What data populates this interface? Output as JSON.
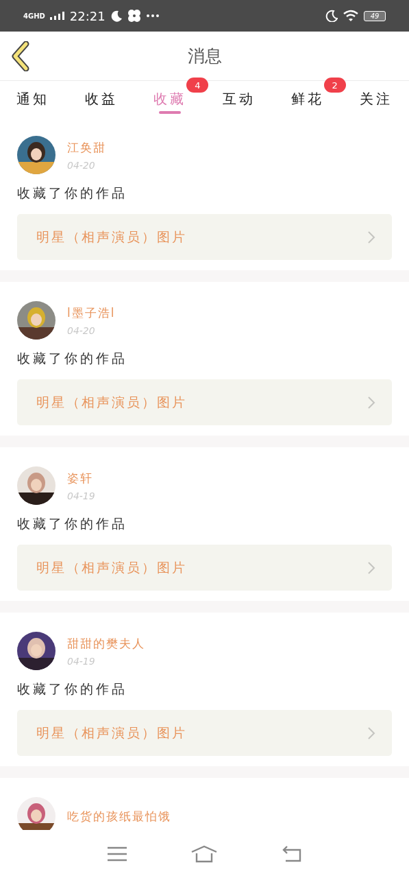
{
  "status_bar": {
    "network": "4GHD",
    "time": "22:21",
    "battery": "49"
  },
  "header": {
    "title": "消息"
  },
  "tabs": [
    {
      "label": "通知",
      "selected": false
    },
    {
      "label": "收益",
      "selected": false
    },
    {
      "label": "收藏",
      "selected": true,
      "badge": "4"
    },
    {
      "label": "互动",
      "selected": false
    },
    {
      "label": "鲜花",
      "selected": false,
      "badge": "2"
    },
    {
      "label": "关注",
      "selected": false
    }
  ],
  "messages": [
    {
      "user": "江奂甜",
      "date": "04-20",
      "text": "收藏了你的作品",
      "work": "明星（相声演员）图片"
    },
    {
      "user": "l墨子浩l",
      "date": "04-20",
      "text": "收藏了你的作品",
      "work": "明星（相声演员）图片"
    },
    {
      "user": "姿轩",
      "date": "04-19",
      "text": "收藏了你的作品",
      "work": "明星（相声演员）图片"
    },
    {
      "user": "甜甜的樊夫人",
      "date": "04-19",
      "text": "收藏了你的作品",
      "work": "明星（相声演员）图片"
    },
    {
      "user": "吃货的孩纸最怕饿"
    }
  ]
}
